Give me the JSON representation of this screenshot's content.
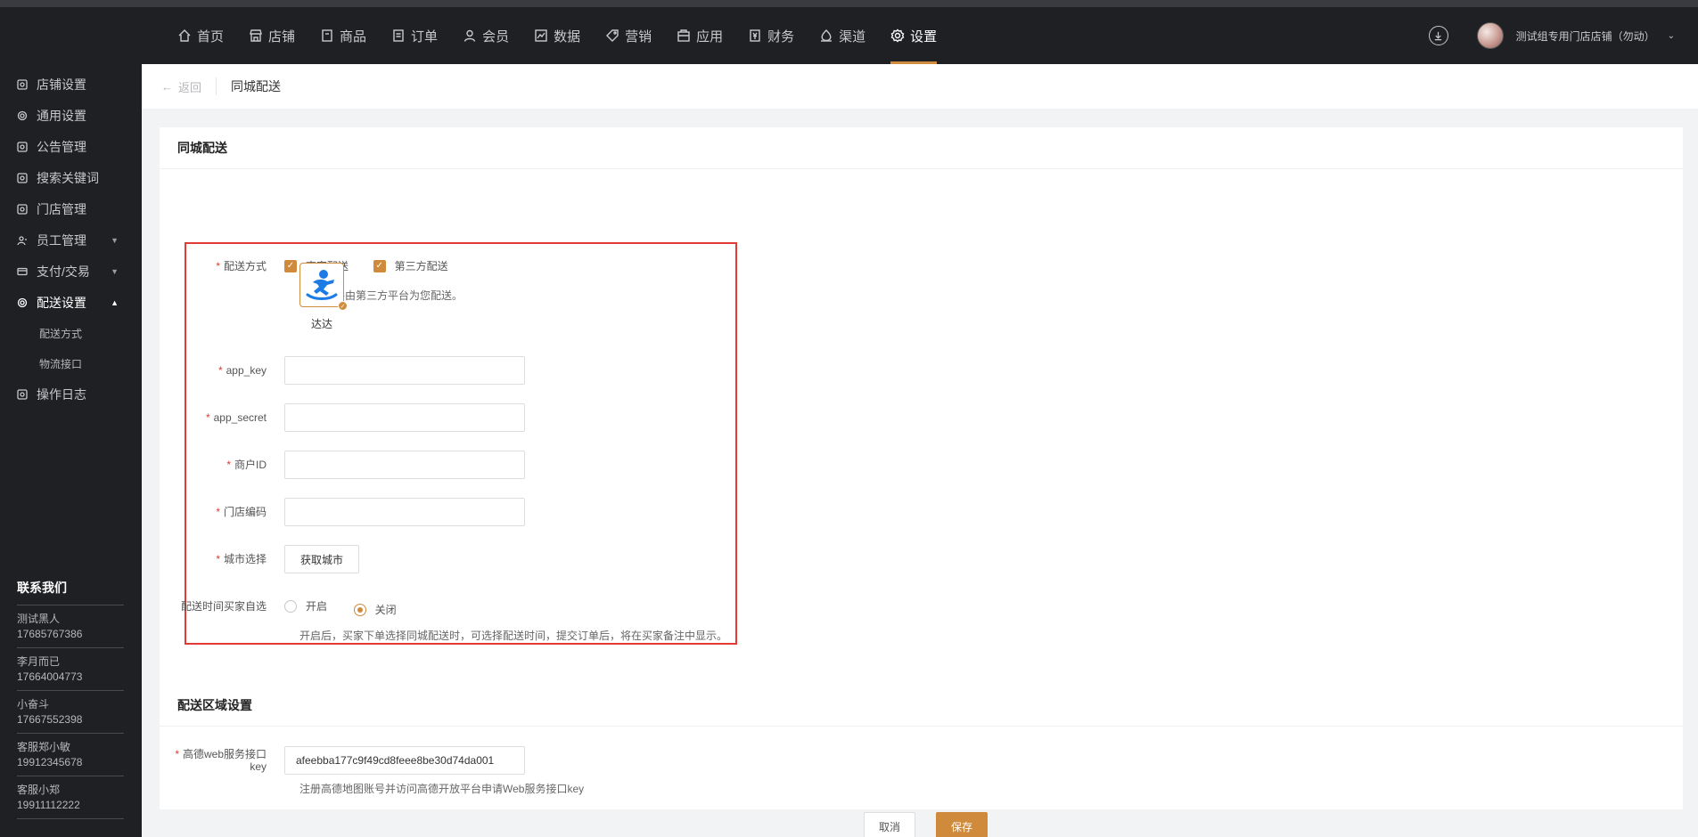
{
  "topnav": {
    "items": [
      {
        "label": "首页",
        "icon": "home-icon"
      },
      {
        "label": "店铺",
        "icon": "store-icon"
      },
      {
        "label": "商品",
        "icon": "goods-icon"
      },
      {
        "label": "订单",
        "icon": "order-icon"
      },
      {
        "label": "会员",
        "icon": "member-icon"
      },
      {
        "label": "数据",
        "icon": "chart-icon"
      },
      {
        "label": "营销",
        "icon": "tag-icon"
      },
      {
        "label": "应用",
        "icon": "app-icon"
      },
      {
        "label": "财务",
        "icon": "finance-icon"
      },
      {
        "label": "渠道",
        "icon": "channel-icon"
      },
      {
        "label": "设置",
        "icon": "settings-icon"
      }
    ],
    "active_index": 10,
    "store_name": "测试组专用门店店铺（勿动）"
  },
  "sidebar": {
    "items": [
      {
        "label": "店铺设置"
      },
      {
        "label": "通用设置"
      },
      {
        "label": "公告管理"
      },
      {
        "label": "搜索关键词"
      },
      {
        "label": "门店管理"
      },
      {
        "label": "员工管理"
      },
      {
        "label": "支付/交易"
      },
      {
        "label": "配送设置"
      },
      {
        "label": "配送方式"
      },
      {
        "label": "物流接口"
      },
      {
        "label": "操作日志"
      }
    ],
    "contact_title": "联系我们",
    "contacts": [
      {
        "name": "测试黑人",
        "phone": "17685767386"
      },
      {
        "name": "李月而已",
        "phone": "17664004773"
      },
      {
        "name": "小奋斗",
        "phone": "17667552398"
      },
      {
        "name": "客服郑小敏",
        "phone": "19912345678"
      },
      {
        "name": "客服小郑",
        "phone": "19911112222"
      }
    ]
  },
  "header": {
    "back_label": "返回",
    "title": "同城配送"
  },
  "section1": {
    "title": "同城配送",
    "delivery_method_label": "配送方式",
    "option_merchant": "商家配送",
    "option_third_party": "第三方配送",
    "third_party_hint": "开启后将由第三方平台为您配送。",
    "provider_name": "达达",
    "app_key_label": "app_key",
    "app_key_value": "",
    "app_secret_label": "app_secret",
    "app_secret_value": "",
    "merchant_id_label": "商户ID",
    "merchant_id_value": "",
    "store_code_label": "门店编码",
    "store_code_value": "",
    "city_label": "城市选择",
    "city_button": "获取城市",
    "buyer_time_label": "配送时间买家自选",
    "radio_on": "开启",
    "radio_off": "关闭",
    "radio_selected": "关闭",
    "buyer_time_hint": "开启后，买家下单选择同城配送时，可选择配送时间，提交订单后，将在买家备注中显示。"
  },
  "section2": {
    "title": "配送区域设置",
    "amap_label": "高德web服务接口key",
    "amap_value": "afeebba177c9f49cd8feee8be30d74da001",
    "amap_hint": "注册高德地图账号并访问高德开放平台申请Web服务接口key"
  },
  "footer": {
    "cancel_label": "取消",
    "save_label": "保存"
  },
  "colors": {
    "accent": "#cf8a3c",
    "dark_bg": "#1f2024",
    "highlight_box": "#e13b34"
  }
}
